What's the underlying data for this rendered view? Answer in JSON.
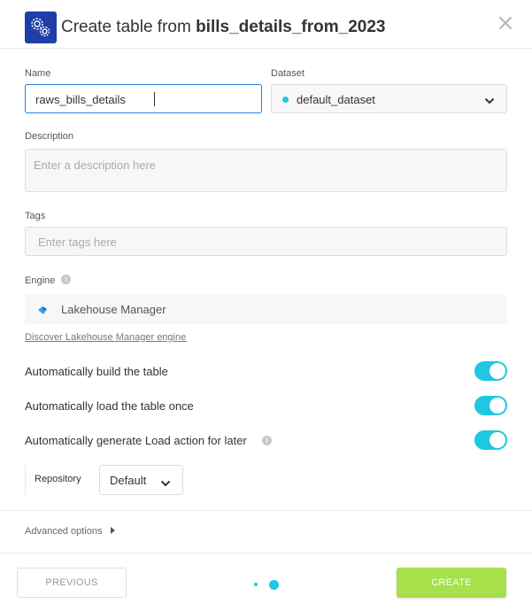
{
  "header": {
    "title_prefix": "Create table from ",
    "title_name": "bills_details_from_2023",
    "icon": "gears-icon",
    "close_icon": "close-icon"
  },
  "form": {
    "name": {
      "label": "Name",
      "value": "raws_bills_details"
    },
    "dataset": {
      "label": "Dataset",
      "value": "default_dataset",
      "dot_color": "#1fc7e0"
    },
    "description": {
      "label": "Description",
      "placeholder": "Enter a description here"
    },
    "tags": {
      "label": "Tags",
      "placeholder": "Enter tags here"
    },
    "engine": {
      "label": "Engine",
      "value": "Lakehouse Manager",
      "discover_link": "Discover Lakehouse Manager engine"
    }
  },
  "options": {
    "auto_build": {
      "label": "Automatically build the table",
      "enabled": true
    },
    "auto_load": {
      "label": "Automatically load the table once",
      "enabled": true
    },
    "auto_generate": {
      "label": "Automatically generate Load action for later",
      "enabled": true
    }
  },
  "repository": {
    "label": "Repository",
    "value": "Default"
  },
  "advanced": {
    "label": "Advanced options"
  },
  "footer": {
    "previous_label": "PREVIOUS",
    "create_label": "CREATE"
  },
  "colors": {
    "accent": "#1fc7e0",
    "create_button": "#a6e04a",
    "header_icon_bg": "#1f3ea8"
  }
}
